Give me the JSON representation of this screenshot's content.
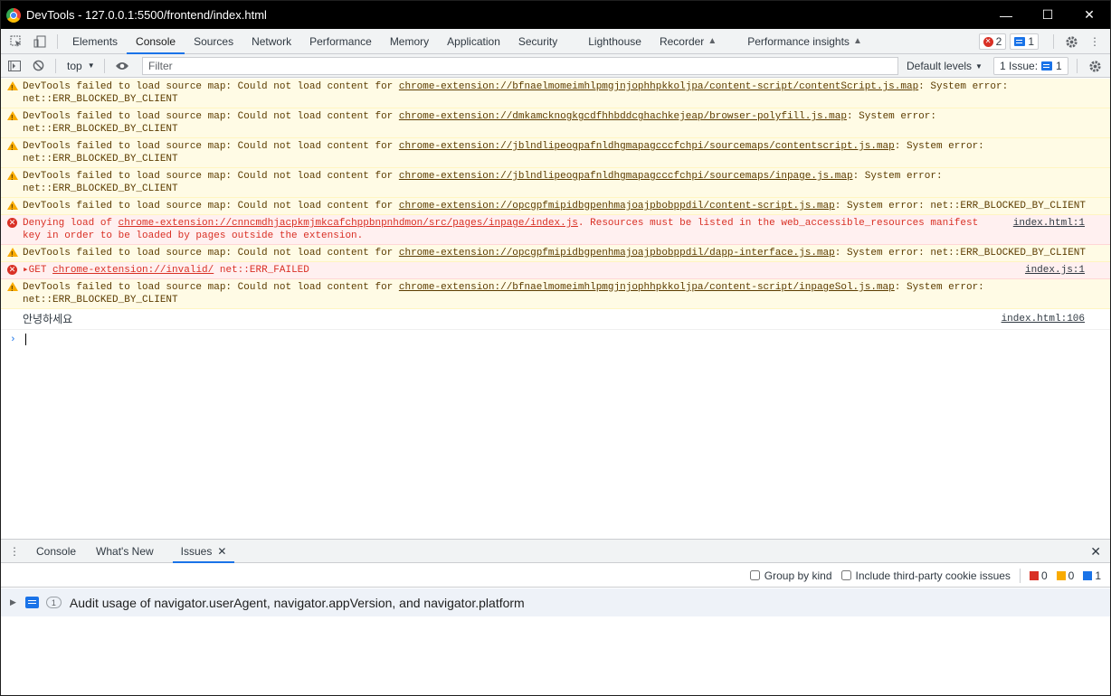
{
  "window": {
    "title": "DevTools - 127.0.0.1:5500/frontend/index.html"
  },
  "tabs": [
    {
      "label": "Elements"
    },
    {
      "label": "Console"
    },
    {
      "label": "Sources"
    },
    {
      "label": "Network"
    },
    {
      "label": "Performance"
    },
    {
      "label": "Memory"
    },
    {
      "label": "Application"
    },
    {
      "label": "Security"
    },
    {
      "label": "Lighthouse"
    },
    {
      "label": "Recorder"
    },
    {
      "label": "Performance insights"
    }
  ],
  "counters": {
    "errors": "2",
    "issues": "1"
  },
  "toolbar": {
    "context": "top",
    "filter_placeholder": "Filter",
    "levels": "Default levels",
    "issues_label": "1 Issue:",
    "issues_count": "1"
  },
  "messages": [
    {
      "level": "warn",
      "pre": "DevTools failed to load source map: Could not load content for ",
      "link": "chrome-extension://bfnaelmomeimhlpmgjnjophhpkkoljpa/content-script/contentScript.js.map",
      "post": ": System error: net::ERR_BLOCKED_BY_CLIENT"
    },
    {
      "level": "warn",
      "pre": "DevTools failed to load source map: Could not load content for ",
      "link": "chrome-extension://dmkamcknogkgcdfhhbddcghachkejeap/browser-polyfill.js.map",
      "post": ": System error: net::ERR_BLOCKED_BY_CLIENT"
    },
    {
      "level": "warn",
      "pre": "DevTools failed to load source map: Could not load content for ",
      "link": "chrome-extension://jblndlipeogpafnldhgmapagcccfchpi/sourcemaps/contentscript.js.map",
      "post": ": System error: net::ERR_BLOCKED_BY_CLIENT"
    },
    {
      "level": "warn",
      "pre": "DevTools failed to load source map: Could not load content for ",
      "link": "chrome-extension://jblndlipeogpafnldhgmapagcccfchpi/sourcemaps/inpage.js.map",
      "post": ": System error: net::ERR_BLOCKED_BY_CLIENT"
    },
    {
      "level": "warn",
      "pre": "DevTools failed to load source map: Could not load content for ",
      "link": "chrome-extension://opcgpfmipidbgpenhmajoajpbobppdil/content-script.js.map",
      "post": ": System error: net::ERR_BLOCKED_BY_CLIENT"
    },
    {
      "level": "error",
      "pre": "Denying load of ",
      "link": "chrome-extension://cnncmdhjacpkmjmkcafchppbnpnhdmon/src/pages/inpage/index.js",
      "post": ". Resources must be listed in the web_accessible_resources manifest key in order to be loaded by pages outside the extension.",
      "source": "index.html:1"
    },
    {
      "level": "warn",
      "pre": "DevTools failed to load source map: Could not load content for ",
      "link": "chrome-extension://opcgpfmipidbgpenhmajoajpbobppdil/dapp-interface.js.map",
      "post": ": System error: net::ERR_BLOCKED_BY_CLIENT"
    },
    {
      "level": "error",
      "pre": "▸GET ",
      "link": "chrome-extension://invalid/",
      "post": " net::ERR_FAILED",
      "source": "index.js:1"
    },
    {
      "level": "warn",
      "pre": "DevTools failed to load source map: Could not load content for ",
      "link": "chrome-extension://bfnaelmomeimhlpmgjnjophhpkkoljpa/content-script/inpageSol.js.map",
      "post": ": System error: net::ERR_BLOCKED_BY_CLIENT"
    }
  ],
  "log": {
    "text": "안녕하세요",
    "source": "index.html:106"
  },
  "drawer": {
    "tabs": [
      {
        "label": "Console"
      },
      {
        "label": "What's New"
      },
      {
        "label": "Issues"
      }
    ],
    "group_by_kind": "Group by kind",
    "third_party": "Include third-party cookie issues",
    "count_errors": "0",
    "count_warnings": "0",
    "count_info": "1",
    "issue": {
      "count": "1",
      "text": "Audit usage of navigator.userAgent, navigator.appVersion, and navigator.platform"
    }
  },
  "colors": {
    "accent": "#1a73e8",
    "error": "#d93025",
    "warning": "#f9ab00"
  }
}
